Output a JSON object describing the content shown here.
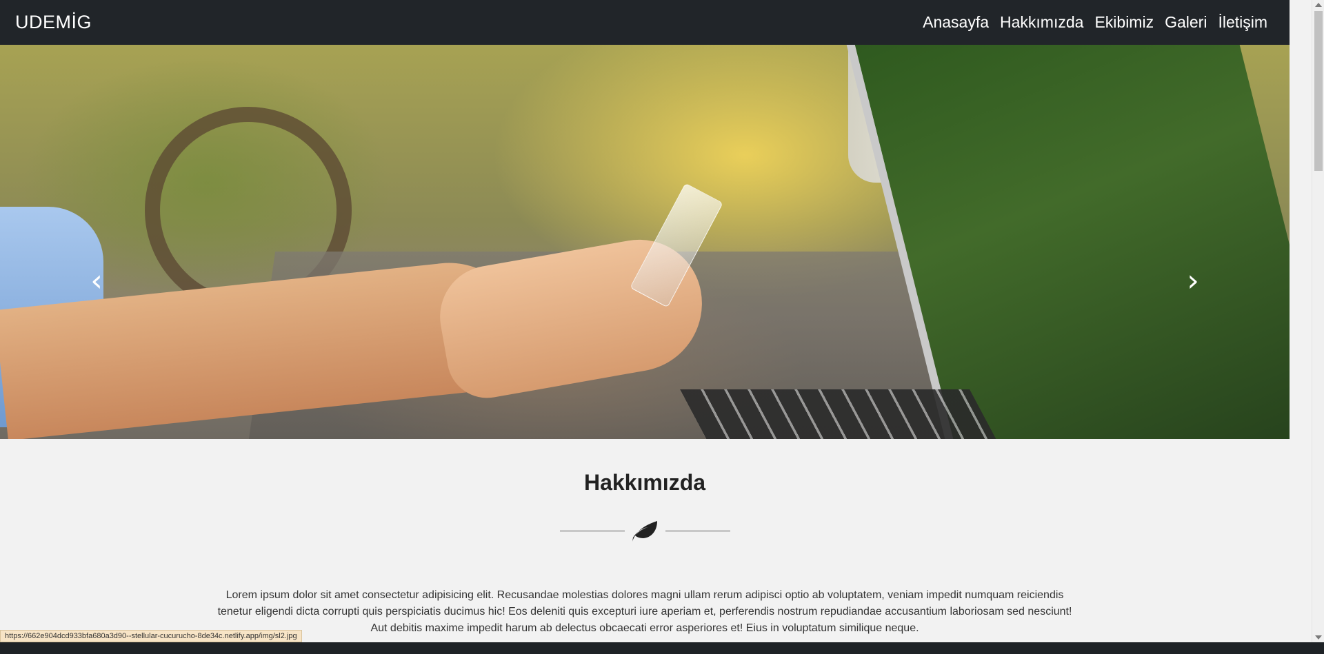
{
  "navbar": {
    "brand": "UDEMİG",
    "links": [
      "Anasayfa",
      "Hakkımızda",
      "Ekibimiz",
      "Galeri",
      "İletişim"
    ]
  },
  "carousel": {
    "prev_icon": "chevron-left-icon",
    "next_icon": "chevron-right-icon",
    "prev_glyph": "‹",
    "next_glyph": "›",
    "slide_count": 3,
    "active_slide": 1
  },
  "about": {
    "title": "Hakkımızda",
    "divider_icon": "leaf-icon",
    "text_lines": [
      "Lorem ipsum dolor sit amet consectetur adipisicing elit. Recusandae molestias dolores magni ullam rerum adipisci optio ab voluptatem, veniam impedit numquam reiciendis",
      "tenetur eligendi dicta corrupti quis perspiciatis ducimus hic! Eos deleniti quis excepturi iure aperiam et, perferendis nostrum repudiandae accusantium laboriosam sed nesciunt!",
      "Aut debitis maxime impedit harum ab delectus obcaecati error asperiores et! Eius in voluptatum similique neque."
    ]
  },
  "status_bar": {
    "url": "https://662e904dcd933bfa680a3d90--stellular-cucurucho-8de34c.netlify.app/img/sl2.jpg"
  },
  "colors": {
    "navbar_bg": "#212529",
    "page_bg": "#f2f2f2",
    "title_text": "#222222"
  }
}
